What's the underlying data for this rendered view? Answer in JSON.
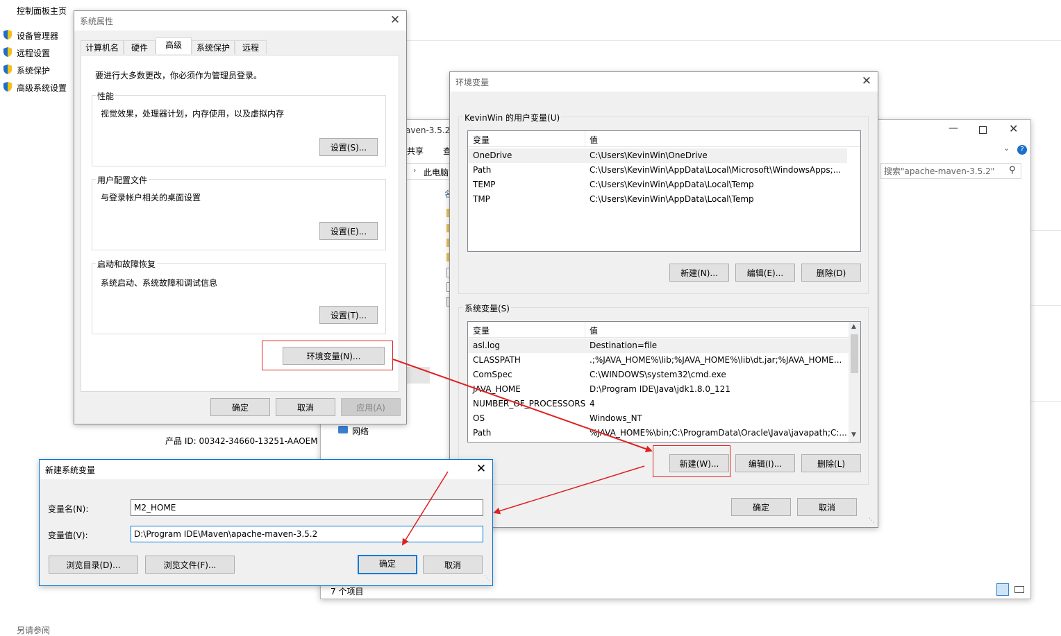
{
  "control_panel": {
    "home": "控制面板主页",
    "links": [
      "设备管理器",
      "远程设置",
      "系统保护",
      "高级系统设置"
    ],
    "product_id": "产品 ID: 00342-34660-13251-AAOEM",
    "bottom_partial": "另请参阅"
  },
  "explorer": {
    "path_partial": "aven-3.5.2",
    "ribbon_share": "共享",
    "ribbon_view_partial": "查",
    "breadcrumb": "此电脑",
    "col_partial": "名",
    "search_placeholder": "搜索\"apache-maven-3.5.2\"",
    "nav_network": "网络",
    "status": "7 个项目"
  },
  "sys_props": {
    "title": "系统属性",
    "tabs": [
      "计算机名",
      "硬件",
      "高级",
      "系统保护",
      "远程"
    ],
    "admin_note": "要进行大多数更改，你必须作为管理员登录。",
    "perf": {
      "label": "性能",
      "desc": "视觉效果，处理器计划，内存使用，以及虚拟内存",
      "button": "设置(S)..."
    },
    "profile": {
      "label": "用户配置文件",
      "desc": "与登录帐户相关的桌面设置",
      "button": "设置(E)..."
    },
    "startup": {
      "label": "启动和故障恢复",
      "desc": "系统启动、系统故障和调试信息",
      "button": "设置(T)..."
    },
    "env_button": "环境变量(N)...",
    "ok": "确定",
    "cancel": "取消",
    "apply": "应用(A)"
  },
  "env_vars": {
    "title": "环境变量",
    "user_section": "KevinWin 的用户变量(U)",
    "col_var": "变量",
    "col_val": "值",
    "user_vars": [
      {
        "name": "OneDrive",
        "value": "C:\\Users\\KevinWin\\OneDrive"
      },
      {
        "name": "Path",
        "value": "C:\\Users\\KevinWin\\AppData\\Local\\Microsoft\\WindowsApps;..."
      },
      {
        "name": "TEMP",
        "value": "C:\\Users\\KevinWin\\AppData\\Local\\Temp"
      },
      {
        "name": "TMP",
        "value": "C:\\Users\\KevinWin\\AppData\\Local\\Temp"
      }
    ],
    "user_new": "新建(N)...",
    "user_edit": "编辑(E)...",
    "user_delete": "删除(D)",
    "sys_section": "系统变量(S)",
    "sys_vars": [
      {
        "name": "asl.log",
        "value": "Destination=file"
      },
      {
        "name": "CLASSPATH",
        "value": ".;%JAVA_HOME%\\lib;%JAVA_HOME%\\lib\\dt.jar;%JAVA_HOME..."
      },
      {
        "name": "ComSpec",
        "value": "C:\\WINDOWS\\system32\\cmd.exe"
      },
      {
        "name": "JAVA_HOME",
        "value": "D:\\Program IDE\\Java\\jdk1.8.0_121"
      },
      {
        "name": "NUMBER_OF_PROCESSORS",
        "value": "4"
      },
      {
        "name": "OS",
        "value": "Windows_NT"
      },
      {
        "name": "Path",
        "value": "%JAVA_HOME%\\bin;C:\\ProgramData\\Oracle\\Java\\javapath;C:..."
      }
    ],
    "sys_new": "新建(W)...",
    "sys_edit": "编辑(I)...",
    "sys_delete": "删除(L)",
    "ok": "确定",
    "cancel": "取消"
  },
  "new_var": {
    "title": "新建系统变量",
    "name_label": "变量名(N):",
    "name_value": "M2_HOME",
    "value_label": "变量值(V):",
    "value_value": "D:\\Program IDE\\Maven\\apache-maven-3.5.2",
    "browse_dir": "浏览目录(D)...",
    "browse_file": "浏览文件(F)...",
    "ok": "确定",
    "cancel": "取消"
  },
  "colors": {
    "accent": "#0078d7",
    "annotation_red": "#e02020",
    "shield_blue": "#1e6fc9",
    "shield_yellow": "#f5c211"
  }
}
